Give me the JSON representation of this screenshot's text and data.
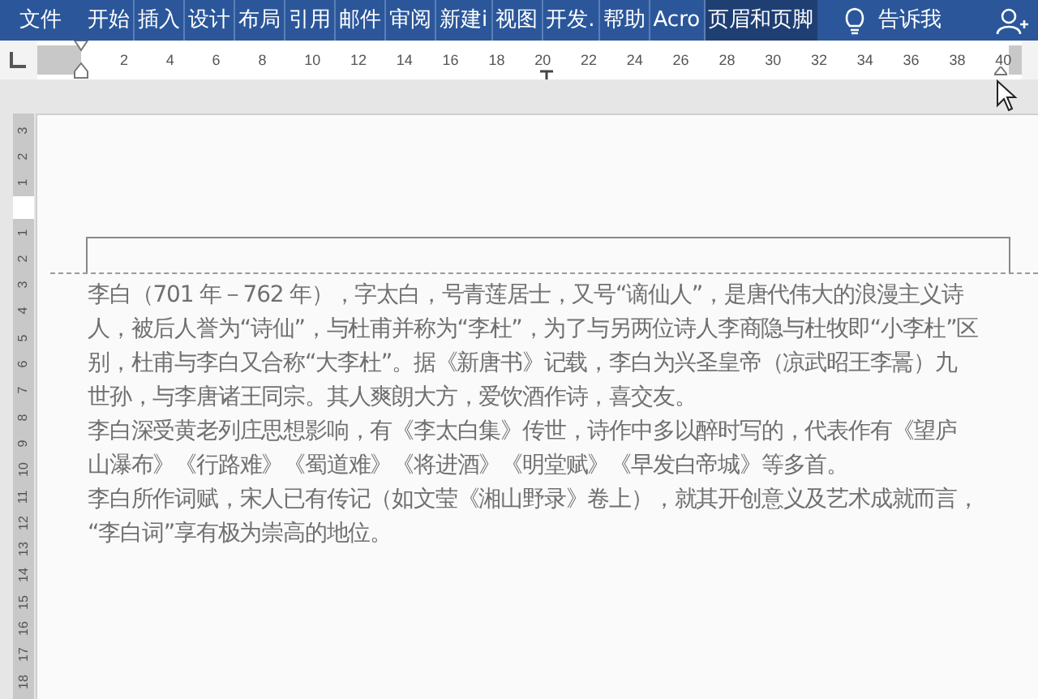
{
  "ribbon": {
    "tabs": [
      {
        "label": "文件",
        "selected": false
      },
      {
        "label": "开始",
        "selected": false
      },
      {
        "label": "插入",
        "selected": false
      },
      {
        "label": "设计",
        "selected": false
      },
      {
        "label": "布局",
        "selected": false
      },
      {
        "label": "引用",
        "selected": false
      },
      {
        "label": "邮件",
        "selected": false
      },
      {
        "label": "审阅",
        "selected": false
      },
      {
        "label": "新建i",
        "selected": false
      },
      {
        "label": "视图",
        "selected": false
      },
      {
        "label": "开发.",
        "selected": false
      },
      {
        "label": "帮助",
        "selected": false
      },
      {
        "label": "Acro",
        "selected": false
      },
      {
        "label": "页眉和页脚",
        "selected": true
      }
    ],
    "tell_me": "告诉我"
  },
  "horizontal_ruler": {
    "numbers": [
      "2",
      "4",
      "6",
      "8",
      "10",
      "12",
      "14",
      "16",
      "18",
      "20",
      "22",
      "24",
      "26",
      "28",
      "30",
      "32",
      "34",
      "36",
      "38",
      "40"
    ]
  },
  "vertical_ruler": {
    "numbers_above": [
      "3",
      "2",
      "1"
    ],
    "numbers_below": [
      "1",
      "2",
      "3",
      "4",
      "5",
      "6",
      "7",
      "8",
      "9",
      "10",
      "11",
      "12",
      "13",
      "14",
      "15",
      "16",
      "17",
      "18"
    ]
  },
  "document": {
    "paragraphs": [
      {
        "lines": [
          "李白（701 年－762 年），字太白，号青莲居士，又号“谪仙人”，是唐代伟大的浪漫主义诗",
          "人，被后人誉为“诗仙”，与杜甫并称为“李杜”，为了与另两位诗人李商隐与杜牧即“小李杜”区",
          "别，杜甫与李白又合称“大李杜”。据《新唐书》记载，李白为兴圣皇帝（凉武昭王李暠）九",
          "世孙，与李唐诸王同宗。其人爽朗大方，爱饮酒作诗，喜交友。"
        ]
      },
      {
        "lines": [
          "李白深受黄老列庄思想影响，有《李太白集》传世，诗作中多以醉时写的，代表作有《望庐",
          "山瀑布》《行路难》《蜀道难》《将进酒》《明堂赋》《早发白帝城》等多首。"
        ]
      },
      {
        "lines": [
          "李白所作词赋，宋人已有传记（如文莹《湘山野录》卷上），就其开创意义及艺术成就而言，",
          "“李白词”享有极为崇高的地位。"
        ]
      }
    ]
  }
}
